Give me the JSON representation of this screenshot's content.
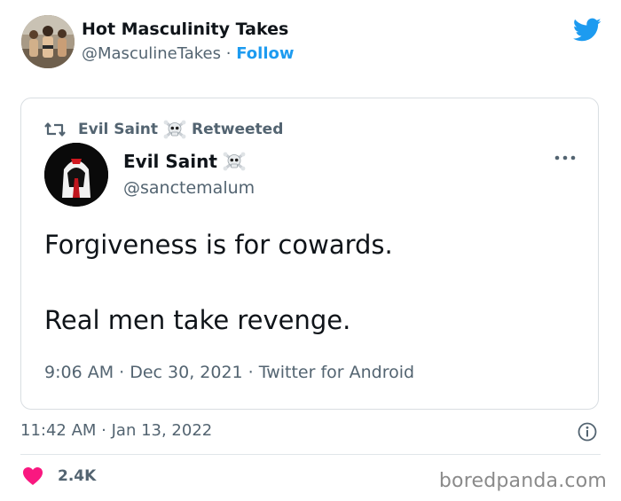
{
  "author": {
    "name": "Hot Masculinity Takes",
    "handle": "@MasculineTakes",
    "separator": "·",
    "follow_label": "Follow"
  },
  "embedded_tweet": {
    "retweet_label_name": "Evil Saint",
    "retweet_label_suffix": "Retweeted",
    "name": "Evil Saint",
    "handle": "@sanctemalum",
    "text_line1": "Forgiveness is for cowards.",
    "text_line2": "Real men take revenge.",
    "meta": "9:06 AM · Dec 30, 2021 · Twitter for Android"
  },
  "tweet_meta": {
    "timestamp": "11:42 AM · Jan 13, 2022"
  },
  "engagement": {
    "likes": "2.4K"
  },
  "watermark": "boredpanda.com",
  "colors": {
    "twitter_blue": "#1d9bf0",
    "like_red": "#f91880",
    "secondary_text": "#536471"
  },
  "icons": [
    "twitter-logo-icon",
    "retweet-icon",
    "skull-crossbones-icon",
    "more-options-icon",
    "info-icon",
    "heart-icon"
  ]
}
